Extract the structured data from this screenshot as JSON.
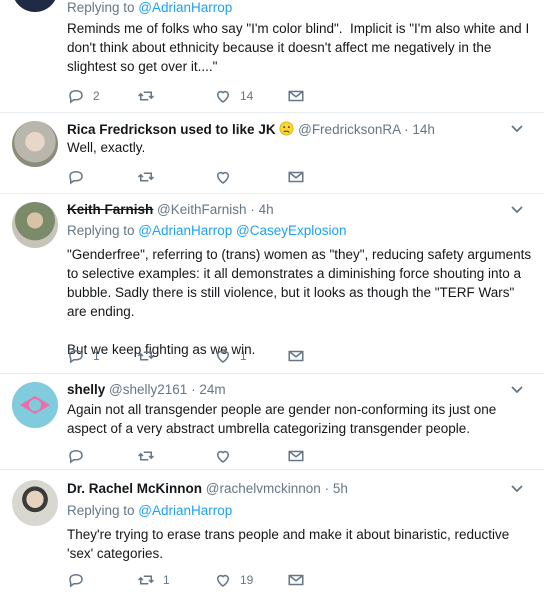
{
  "colors": {
    "link": "#1da1f2",
    "muted": "#657786",
    "text": "#14171a",
    "divider": "#e6ecf0"
  },
  "tweets": [
    {
      "replying_prefix": "Replying to ",
      "replying_to": "@AdrianHarrop",
      "text": "Reminds me of folks who say \"I'm color blind\".  Implicit is \"I'm also white and I don't think about ethnicity because it doesn't affect me negatively in the slightest so get over it....\"",
      "replies": "2",
      "retweets": "",
      "likes": "14"
    },
    {
      "name": "Rica Fredrickson used to like JK",
      "emoji": "confused-face",
      "handle": "@FredricksonRA",
      "dot": "·",
      "time": "14h",
      "text": "Well, exactly.",
      "replies": "",
      "retweets": "",
      "likes": ""
    },
    {
      "name": "Keith Farnish",
      "handle": "@KeithFarnish",
      "dot": "·",
      "time": "4h",
      "replying_prefix": "Replying to ",
      "replying_to": "@AdrianHarrop @CaseyExplosion",
      "text": "\"Genderfree\", referring to (trans) women as \"they\", reducing safety arguments to selective examples: it all demonstrates a diminishing force shouting into a bubble. Sadly there is still violence, but it looks as though the \"TERF Wars\" are ending.\n\nBut we keep fighting as we win.",
      "replies": "1",
      "retweets": "",
      "likes": "1"
    },
    {
      "name": "shelly",
      "handle": "@shelly2161",
      "dot": "·",
      "time": "24m",
      "text": "Again not all transgender people are gender non-conforming its just one aspect of a very abstract umbrella categorizing transgender people.",
      "replies": "",
      "retweets": "",
      "likes": ""
    },
    {
      "name": "Dr. Rachel McKinnon",
      "handle": "@rachelvmckinnon",
      "dot": "·",
      "time": "5h",
      "replying_prefix": "Replying to ",
      "replying_to": "@AdrianHarrop",
      "text": "They're trying to erase trans people and make it about binaristic, reductive 'sex' categories.",
      "replies": "",
      "retweets": "1",
      "likes": "19"
    }
  ]
}
